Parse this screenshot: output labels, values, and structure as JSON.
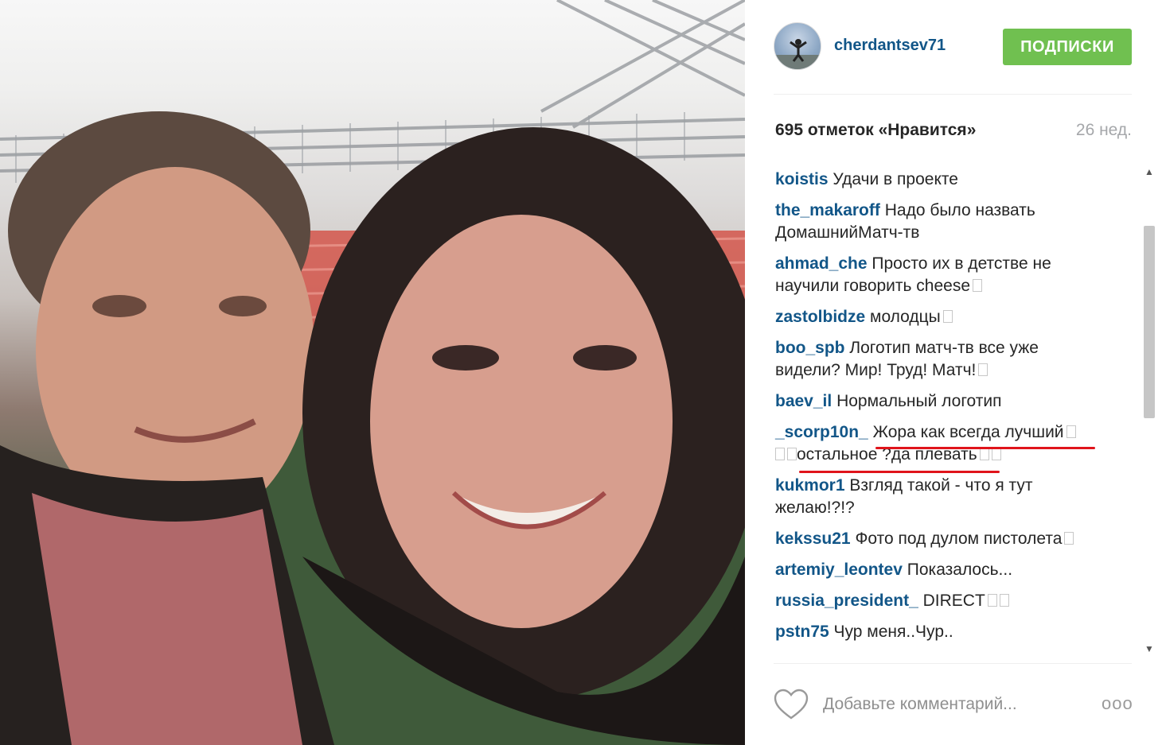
{
  "post": {
    "username": "cherdantsev71",
    "follow_label": "ПОДПИСКИ",
    "likes": "695 отметок «Нравится»",
    "time": "26 нед."
  },
  "comments": [
    {
      "user": "koistis",
      "text": "Удачи в проекте"
    },
    {
      "user": "the_makaroff",
      "text": "Надо было назвать ДомашнийМатч-тв"
    },
    {
      "user": "ahmad_che",
      "text": "Просто их в детстве не научили говорить cheese"
    },
    {
      "user": "zastolbidze",
      "text": "молодцы"
    },
    {
      "user": "boo_spb",
      "text": "Логотип матч-тв все уже видели? Мир! Труд! Матч!"
    },
    {
      "user": "baev_il",
      "text": "Нормальный логотип"
    },
    {
      "user": "_scorp10n_",
      "text": "Жора как всегда лучший",
      "text2": "остальное ?да плевать"
    },
    {
      "user": "kukmor1",
      "text": "Взгляд такой - что я тут желаю!?!?"
    },
    {
      "user": "kekssu21",
      "text": "Фото под дулом пистолета"
    },
    {
      "user": "artemiy_leontev",
      "text": "Показалось..."
    },
    {
      "user": "russia_president_",
      "text": "DIRECT"
    },
    {
      "user": "pstn75",
      "text": "Чур меня..Чур.."
    }
  ],
  "comment_input": {
    "placeholder": "Добавьте комментарий..."
  },
  "more_label": "ooo",
  "icons": {
    "like": "heart-outline-icon",
    "more": "ellipsis-icon",
    "scroll_up": "scroll-up-arrow-icon",
    "scroll_down": "scroll-down-arrow-icon"
  },
  "colors": {
    "username": "#125688",
    "follow": "#70c050",
    "annotation": "#e0141b"
  }
}
